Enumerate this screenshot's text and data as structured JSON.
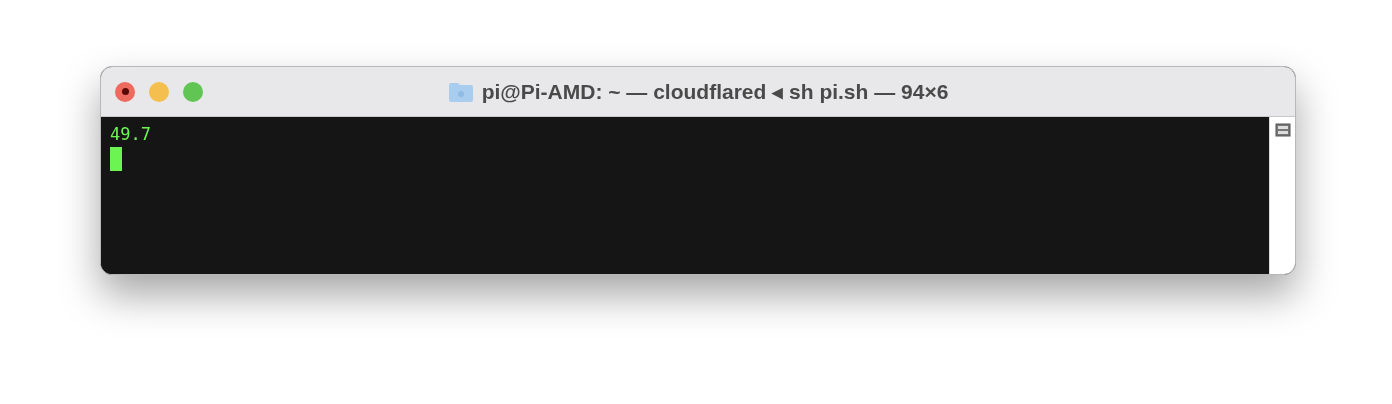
{
  "window": {
    "title": "pi@Pi-AMD: ~ — cloudflared ◂ sh pi.sh — 94×6"
  },
  "terminal": {
    "lines": [
      "49.7"
    ],
    "cursor_visible": true
  }
}
